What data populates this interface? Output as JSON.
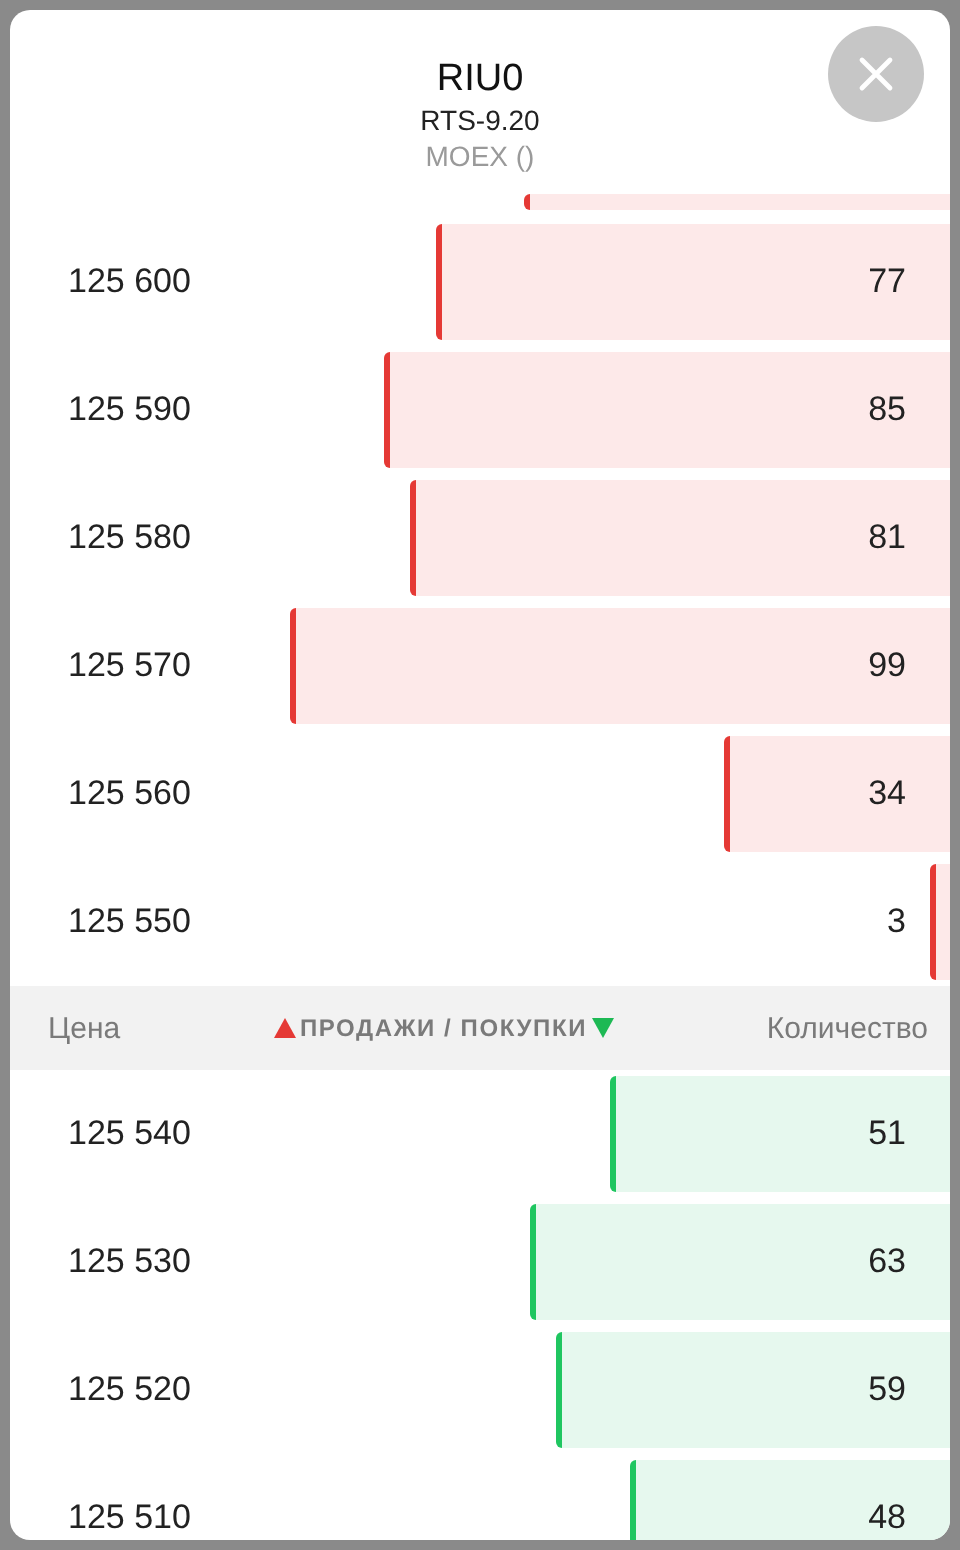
{
  "header": {
    "title": "RIU0",
    "subtitle": "RTS-9.20",
    "exchange": "MOEX ()"
  },
  "sells": [
    {
      "price": "125 600",
      "quantity": "77"
    },
    {
      "price": "125 590",
      "quantity": "85"
    },
    {
      "price": "125 580",
      "quantity": "81"
    },
    {
      "price": "125 570",
      "quantity": "99"
    },
    {
      "price": "125 560",
      "quantity": "34"
    },
    {
      "price": "125 550",
      "quantity": "3"
    }
  ],
  "columns": {
    "price": "Цена",
    "sides": "ПРОДАЖИ / ПОКУПКИ",
    "quantity": "Количество"
  },
  "buys": [
    {
      "price": "125 540",
      "quantity": "51"
    },
    {
      "price": "125 530",
      "quantity": "63"
    },
    {
      "price": "125 520",
      "quantity": "59"
    },
    {
      "price": "125 510",
      "quantity": "48"
    }
  ]
}
